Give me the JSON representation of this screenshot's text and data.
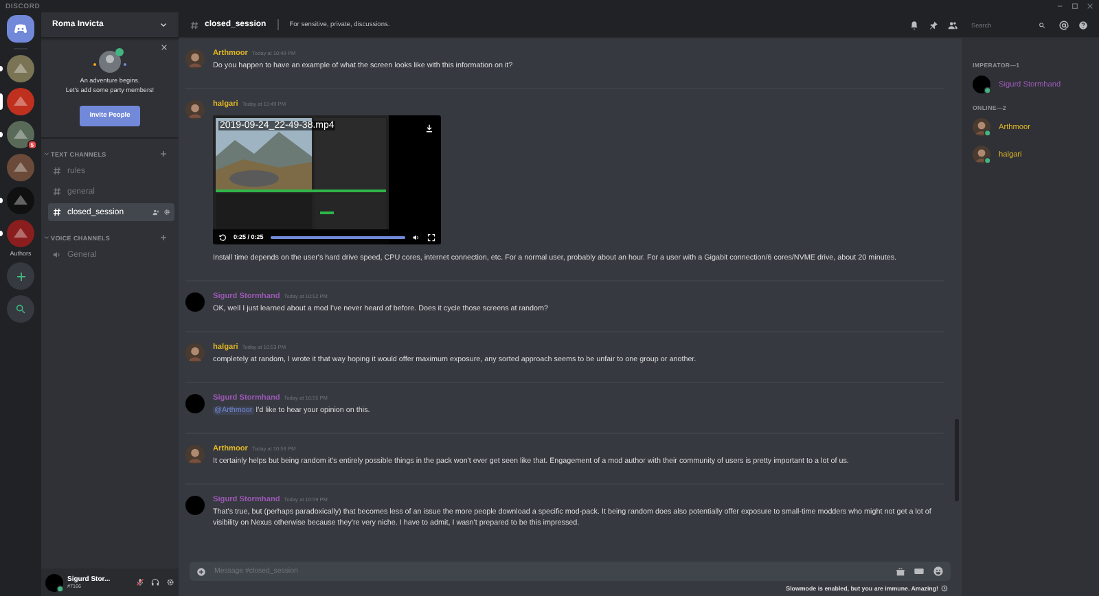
{
  "window": {
    "title": "DISCORD"
  },
  "servers": [
    {
      "color": "#7a7455",
      "selected": false,
      "unread": true
    },
    {
      "color": "#c0301e",
      "selected": true,
      "unread": false
    },
    {
      "color": "#5a6a58",
      "selected": false,
      "unread": true,
      "badge": "5"
    },
    {
      "color": "#6b4a3a",
      "selected": false,
      "unread": false
    },
    {
      "color": "#101010",
      "selected": false,
      "unread": true
    },
    {
      "color": "#8a1e1e",
      "selected": false,
      "unread": true
    }
  ],
  "folder_label": "Authors",
  "guild": {
    "name": "Roma Invicta"
  },
  "invite_card": {
    "line1": "An adventure begins.",
    "line2": "Let's add some party members!",
    "button": "Invite People"
  },
  "categories": [
    {
      "name": "TEXT CHANNELS",
      "expanded": true,
      "channels": [
        {
          "name": "rules",
          "kind": "text",
          "selected": false
        },
        {
          "name": "general",
          "kind": "text",
          "selected": false
        },
        {
          "name": "closed_session",
          "kind": "text",
          "selected": true
        }
      ]
    },
    {
      "name": "VOICE CHANNELS",
      "expanded": true,
      "channels": [
        {
          "name": "General",
          "kind": "voice",
          "selected": false
        }
      ]
    }
  ],
  "user_panel": {
    "name": "Sigurd Stor...",
    "tag": "#7166",
    "muted": true
  },
  "header": {
    "channel": "closed_session",
    "topic": "For sensitive, private, discussions.",
    "search_placeholder": "Search"
  },
  "messages": [
    {
      "author": "Arthmoor",
      "color": "#e1b725",
      "time": "Today at 10:49 PM",
      "text": "Do you happen to have an example of what the screen looks like with this information on it?"
    },
    {
      "author": "halgari",
      "color": "#e1b725",
      "time": "Today at 10:49 PM",
      "attachment": {
        "kind": "video",
        "filename": "2019-09-24_22-49-38.mp4",
        "time": "0:25 / 0:25",
        "level": 1
      },
      "text": "Install time depends on the user's hard drive speed, CPU cores, internet connection, etc. For a normal user, probably about an hour. For a user with a Gigabit connection/6 cores/NVME drive, about 20 minutes."
    },
    {
      "author": "Sigurd Stormhand",
      "color": "#9b59b6",
      "time": "Today at 10:52 PM",
      "avatar": {
        "kind": "plain"
      },
      "text": "OK, well I just learned about a mod I've never heard of before. Does it cycle those screens at random?"
    },
    {
      "author": "halgari",
      "color": "#e1b725",
      "time": "Today at 10:53 PM",
      "text": "completely at random, I wrote it that way hoping it would offer maximum exposure, any sorted approach seems to be unfair to one group or another."
    },
    {
      "author": "Sigurd Stormhand",
      "color": "#9b59b6",
      "time": "Today at 10:55 PM",
      "avatar": {
        "kind": "plain"
      },
      "mention": "@Arthmoor",
      "text": "I'd like to hear your opinion on this."
    },
    {
      "author": "Arthmoor",
      "color": "#e1b725",
      "time": "Today at 10:56 PM",
      "text": "It certainly helps but being random it's entirely possible things in the pack won't ever get seen like that. Engagement of a mod author with their community of users is pretty important to a lot of us."
    },
    {
      "author": "Sigurd Stormhand",
      "color": "#9b59b6",
      "time": "Today at 10:59 PM",
      "avatar": {
        "kind": "plain"
      },
      "text": "That's true, but (perhaps paradoxically) that becomes less of an issue the more people download a specific mod-pack. It being random does also potentially offer exposure to small-time modders who might not get a lot of visibility on Nexus otherwise because they're very niche. I have to admit, I wasn't prepared to be this impressed."
    }
  ],
  "composer": {
    "placeholder": "Message #closed_session",
    "notice": "Slowmode is enabled, but you are immune. Amazing!"
  },
  "members": [
    {
      "title": "IMPERATOR—1",
      "people": [
        {
          "name": "Sigurd Stormhand",
          "color": "#9b59b6",
          "avatar": {
            "kind": "plain"
          },
          "online": true
        }
      ]
    },
    {
      "title": "ONLINE—2",
      "people": [
        {
          "name": "Arthmoor",
          "color": "#e1b725",
          "online": true
        },
        {
          "name": "halgari",
          "color": "#e1b725",
          "online": true
        }
      ]
    }
  ]
}
